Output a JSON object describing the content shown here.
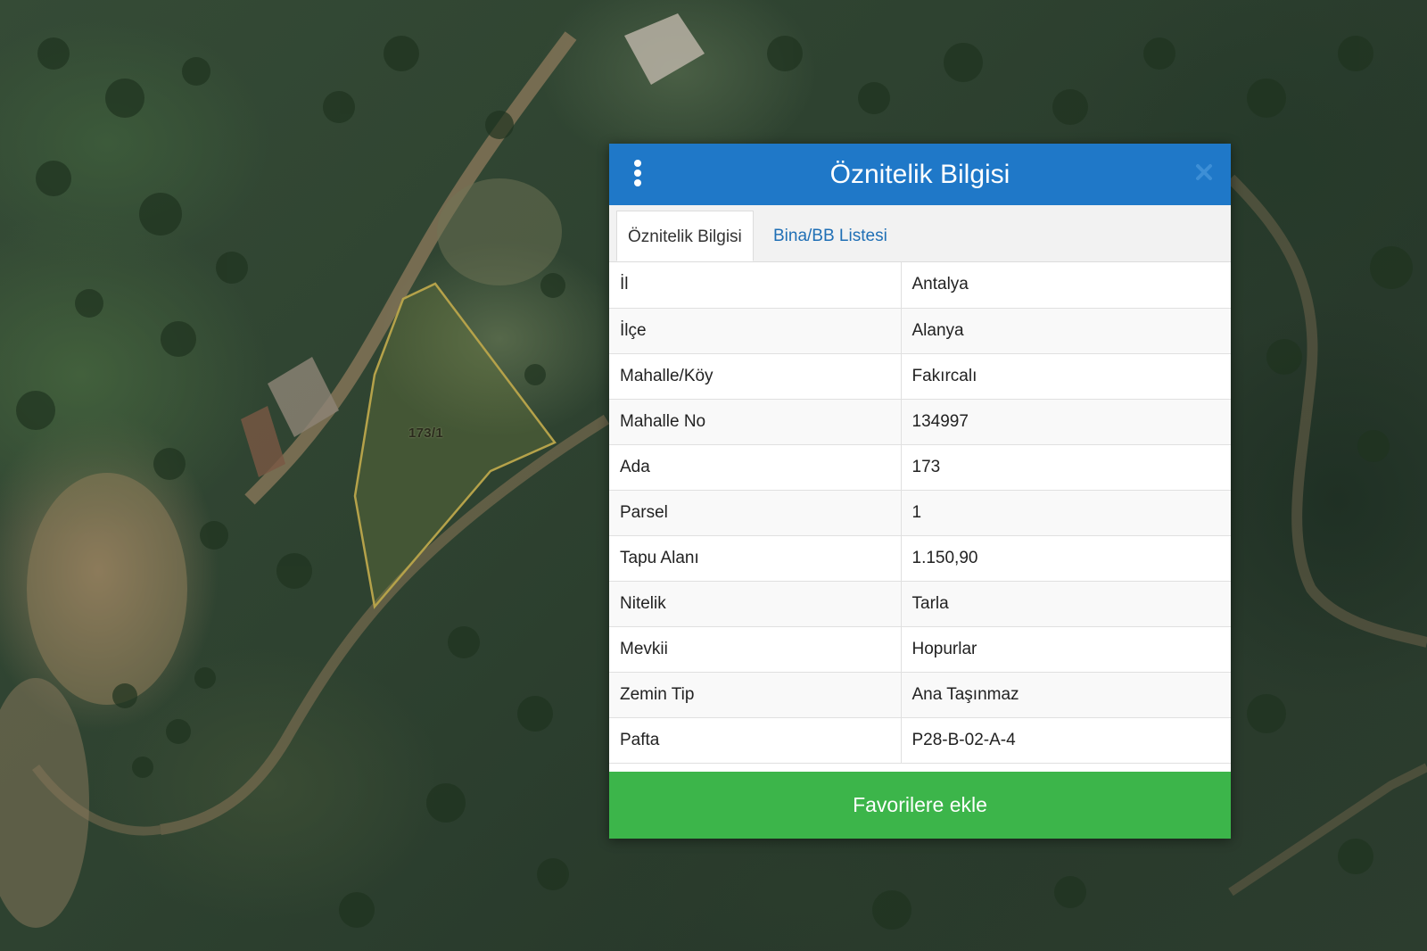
{
  "map": {
    "parcel_label": "173/1"
  },
  "dialog": {
    "title": "Öznitelik Bilgisi",
    "menu_icon": "vertical-dots-icon",
    "close_icon": "close-icon",
    "header_color": "#1f78c8",
    "tabs": [
      {
        "label": "Öznitelik Bilgisi",
        "active": true
      },
      {
        "label": "Bina/BB Listesi",
        "active": false
      }
    ],
    "rows": [
      {
        "key": "İl",
        "value": "Antalya"
      },
      {
        "key": "İlçe",
        "value": "Alanya"
      },
      {
        "key": "Mahalle/Köy",
        "value": "Fakırcalı"
      },
      {
        "key": "Mahalle No",
        "value": "134997"
      },
      {
        "key": "Ada",
        "value": "173"
      },
      {
        "key": "Parsel",
        "value": "1"
      },
      {
        "key": "Tapu Alanı",
        "value": "1.150,90"
      },
      {
        "key": "Nitelik",
        "value": "Tarla"
      },
      {
        "key": "Mevkii",
        "value": "Hopurlar"
      },
      {
        "key": "Zemin Tip",
        "value": "Ana Taşınmaz"
      },
      {
        "key": "Pafta",
        "value": "P28-B-02-A-4"
      }
    ],
    "favorite_button": "Favorilere ekle",
    "favorite_color": "#3cb54a"
  }
}
